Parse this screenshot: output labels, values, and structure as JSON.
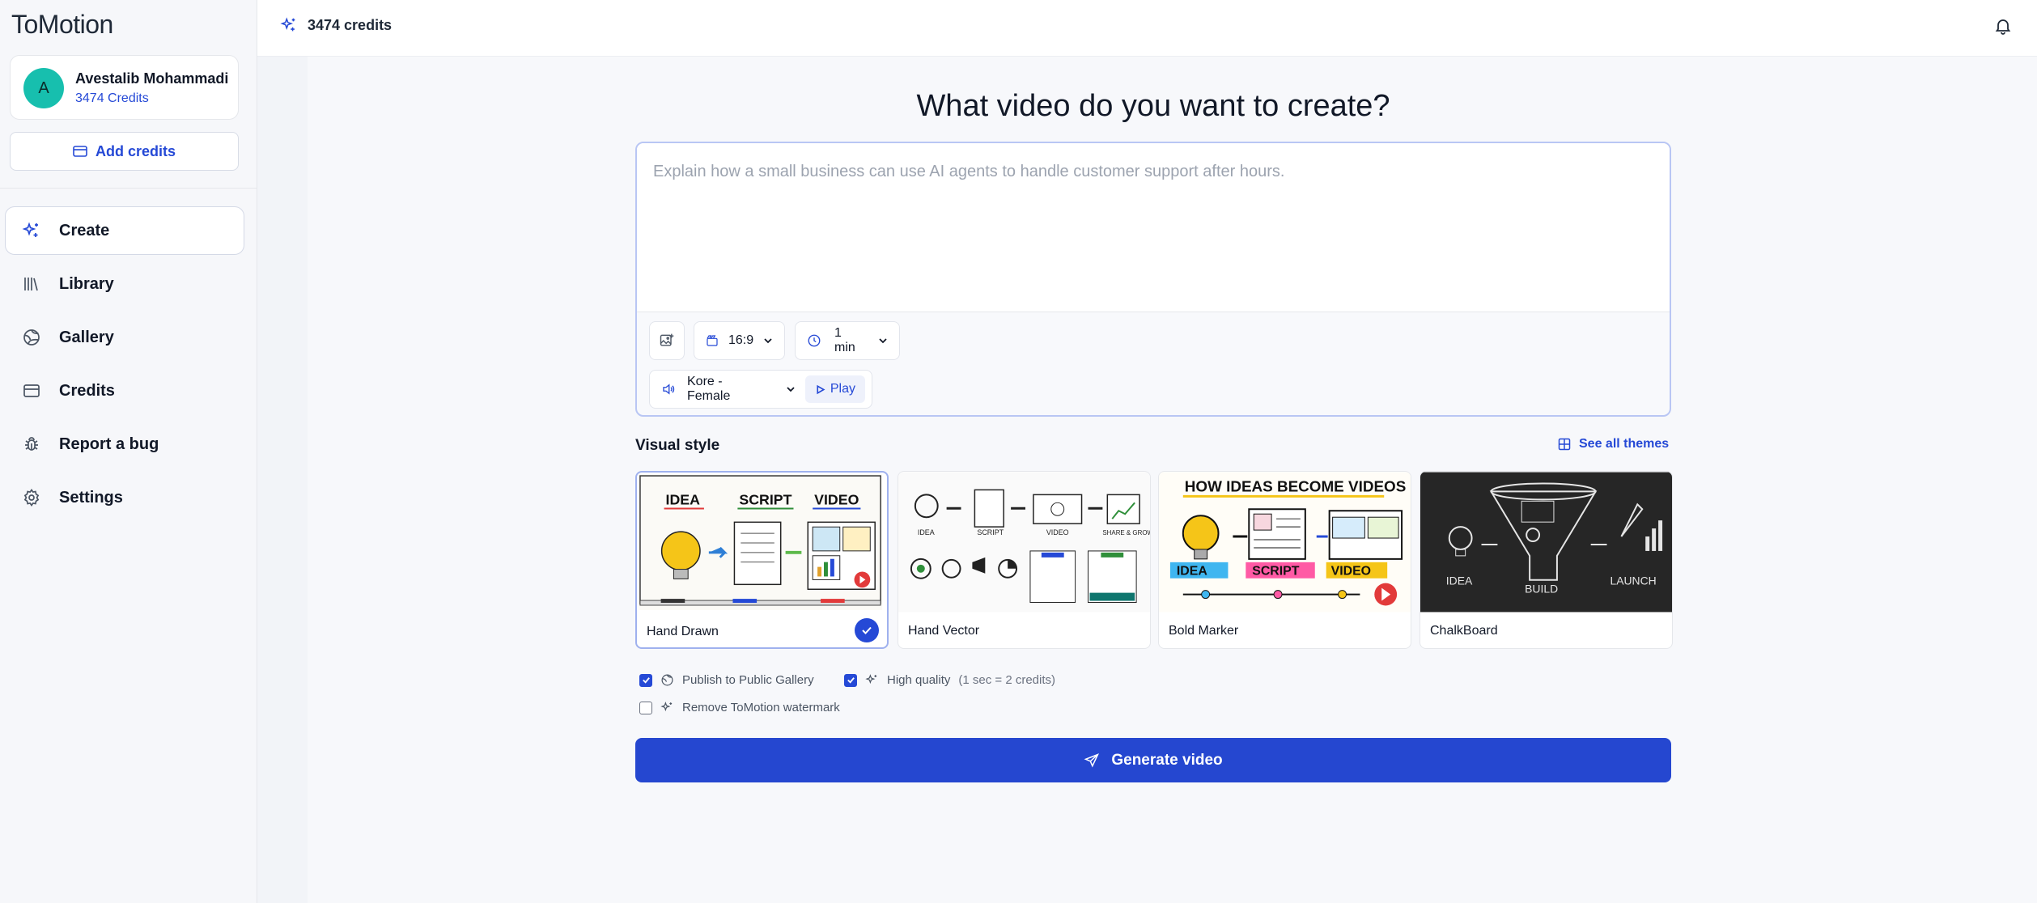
{
  "app": {
    "logo": "ToMotion"
  },
  "user": {
    "initial": "A",
    "name": "Avestalib Mohammadi",
    "credits": "3474 Credits"
  },
  "sidebar": {
    "add_credits": "Add credits",
    "items": [
      {
        "label": "Create",
        "icon": "sparkle-icon",
        "active": true
      },
      {
        "label": "Library",
        "icon": "library-icon"
      },
      {
        "label": "Gallery",
        "icon": "gallery-icon"
      },
      {
        "label": "Credits",
        "icon": "credit-card-icon"
      },
      {
        "label": "Report a bug",
        "icon": "bug-icon"
      },
      {
        "label": "Settings",
        "icon": "gear-icon"
      }
    ]
  },
  "topbar": {
    "credits": "3474 credits"
  },
  "main": {
    "headline": "What video do you want to create?",
    "prompt_placeholder": "Explain how a small business can use AI agents to handle customer support after hours.",
    "aspect_ratio": "16:9",
    "duration": "1 min",
    "voice": "Kore - Female",
    "play": "Play",
    "visual_style_label": "Visual style",
    "see_all_themes": "See all themes",
    "themes": [
      {
        "name": "Hand Drawn",
        "selected": true
      },
      {
        "name": "Hand Vector",
        "selected": false
      },
      {
        "name": "Bold Marker",
        "selected": false
      },
      {
        "name": "ChalkBoard",
        "selected": false
      }
    ],
    "options": {
      "publish": {
        "label": "Publish to Public Gallery",
        "checked": true
      },
      "high_quality": {
        "label": "High quality",
        "note": "(1 sec = 2 credits)",
        "checked": true
      },
      "remove_watermark": {
        "label": "Remove ToMotion watermark",
        "checked": false
      }
    },
    "generate": "Generate video"
  },
  "thumb_text": {
    "hand_drawn": [
      "IDEA",
      "SCRIPT",
      "VIDEO"
    ],
    "hand_vector": [
      "IDEA",
      "SCRIPT",
      "VIDEO",
      "SHARE & GROW"
    ],
    "bold_marker": {
      "title": "HOW IDEAS BECOME VIDEOS",
      "labels": [
        "IDEA",
        "SCRIPT",
        "VIDEO"
      ]
    },
    "chalkboard": [
      "IDEA",
      "BUILD",
      "LAUNCH"
    ]
  },
  "colors": {
    "accent": "#2549d6",
    "avatar": "#17bfae",
    "generate": "#2547d0"
  }
}
